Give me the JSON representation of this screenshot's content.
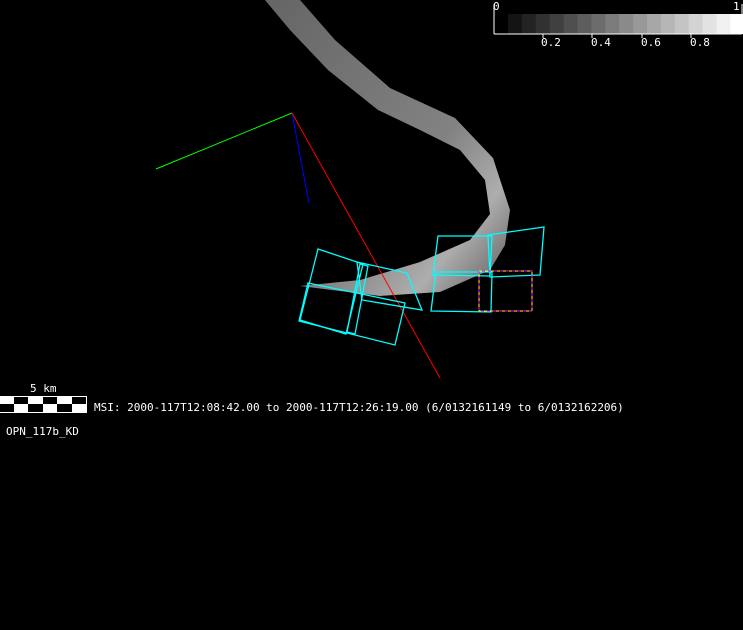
{
  "colorbar": {
    "min_label": "0",
    "max_label": "1",
    "ticks": [
      "0.2",
      "0.4",
      "0.6",
      "0.8"
    ]
  },
  "scale_bar": {
    "label": "5 km"
  },
  "info_line": "MSI:  2000-117T12:08:42.00 to 2000-117T12:26:19.00 (6/0132161149 to 6/0132162206)",
  "observation_id": "OPN_117b_KD",
  "colors": {
    "footprint": "#00ffff",
    "x_axis": "#ff0000",
    "y_axis": "#00ff00",
    "z_axis": "#0000ff",
    "highlight_a": "#ffff00",
    "highlight_b": "#ff00ff"
  }
}
